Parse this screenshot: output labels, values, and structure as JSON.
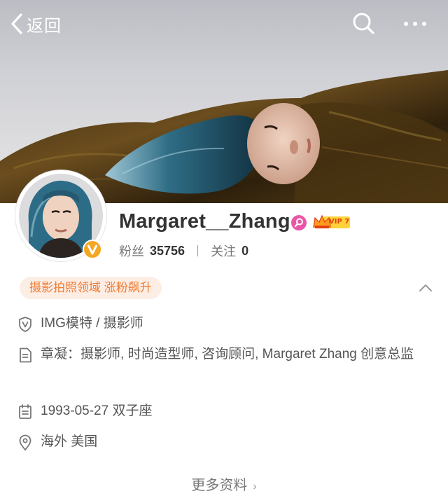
{
  "nav": {
    "back_label": "返回",
    "back_icon": "chevron-left-icon",
    "search_icon": "search-icon",
    "more_icon": "more-dots-icon"
  },
  "profile": {
    "name": "Margaret__Zhang",
    "vip_label": "VIP 7",
    "verified_icon": "verified-v-icon",
    "stats": {
      "fans_label": "粉丝",
      "fans_value": "35756",
      "following_label": "关注",
      "following_value": "0"
    }
  },
  "tag": {
    "label": "摄影拍照领域 涨粉飙升"
  },
  "info": {
    "verification": "IMG模特 / 摄影师",
    "bio": "章凝：摄影师, 时尚造型师, 咨询顾问, Margaret Zhang 创意总监",
    "birthday": "1993-05-27 双子座",
    "location": "海外 美国"
  },
  "more_info_label": "更多资料",
  "colors": {
    "accent_orange": "#f07b32",
    "tag_bg": "#fdeee5",
    "badge_pink": "#e857a6",
    "verified_gold": "#f5a623"
  }
}
